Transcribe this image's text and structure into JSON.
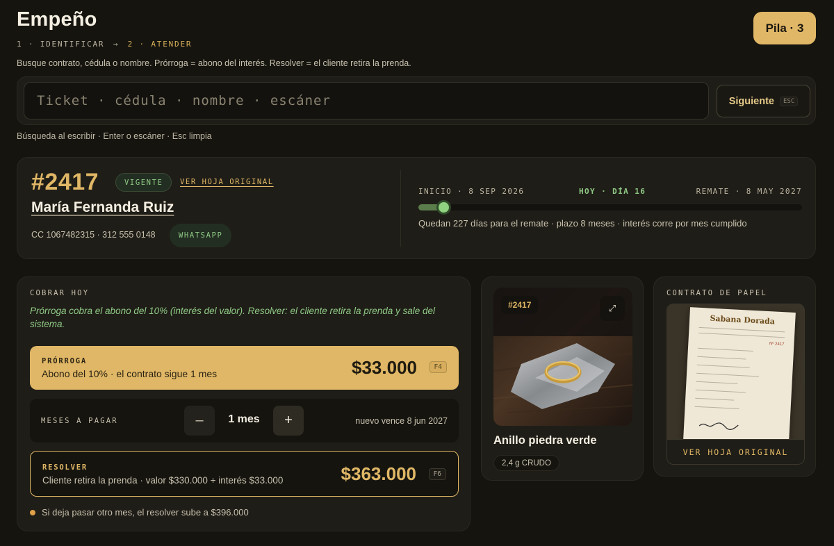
{
  "header": {
    "title": "Empeño",
    "steps": [
      "1 · IDENTIFICAR",
      "2 · ATENDER"
    ],
    "subtitle": "Busque contrato, cédula o nombre. Prórroga = abono del interés. Resolver = el cliente retira la prenda.",
    "stack_badge": "Pila · 3"
  },
  "search": {
    "placeholder": "Ticket · cédula · nombre · escáner",
    "value": "",
    "next_label": "Siguiente",
    "next_key": "ESC",
    "hint": "Búsqueda al escribir · Enter o escáner · Esc limpia"
  },
  "contract": {
    "ticket": "#2417",
    "status": "VIGENTE",
    "view_original": "VER HOJA ORIGINAL",
    "client_name": "María Fernanda Ruiz",
    "contact": "CC 1067482315 · 312 555 0148",
    "whatsapp": "WHATSAPP",
    "timeline_start": "INICIO · 8 SEP 2026",
    "timeline_today": "HOY · DÍA 16",
    "timeline_end": "REMATE · 8 MAY 2027",
    "timeline_progress": 0.065,
    "timeline_note": "Quedan 227 días para el remate · plazo 8 meses · interés corre por mes cumplido"
  },
  "charge": {
    "title": "COBRAR HOY",
    "description": "Prórroga cobra el abono del 10% (interés del valor). Resolver: el cliente retira la prenda y sale del sistema.",
    "extension": {
      "label": "PRÓRROGA",
      "description": "Abono del 10% · el contrato sigue 1 mes",
      "amount": "$33.000",
      "key": "F4"
    },
    "months": {
      "label": "MESES A PAGAR",
      "minus": "–",
      "value": "1 mes",
      "plus": "+",
      "new_due": "nuevo vence 8 jun 2027"
    },
    "resolve": {
      "label": "RESOLVER",
      "description": "Cliente retira la prenda · valor $330.000 + interés $33.000",
      "amount": "$363.000",
      "key": "F6"
    },
    "warning": "Si deja pasar otro mes, el resolver sube a $396.000"
  },
  "item": {
    "badge": "#2417",
    "expand_icon": "⤢",
    "name": "Anillo piedra verde",
    "tag": "2,4 g CRUDO"
  },
  "paper": {
    "title": "CONTRATO DE PAPEL",
    "sheet_brand": "Sabana Dorada",
    "sheet_number": "Nº 2417",
    "view_button": "VER HOJA ORIGINAL"
  },
  "colors": {
    "accent": "#e0b766",
    "success": "#8fca86",
    "background": "#15140f",
    "panel": "#1f1d17"
  }
}
